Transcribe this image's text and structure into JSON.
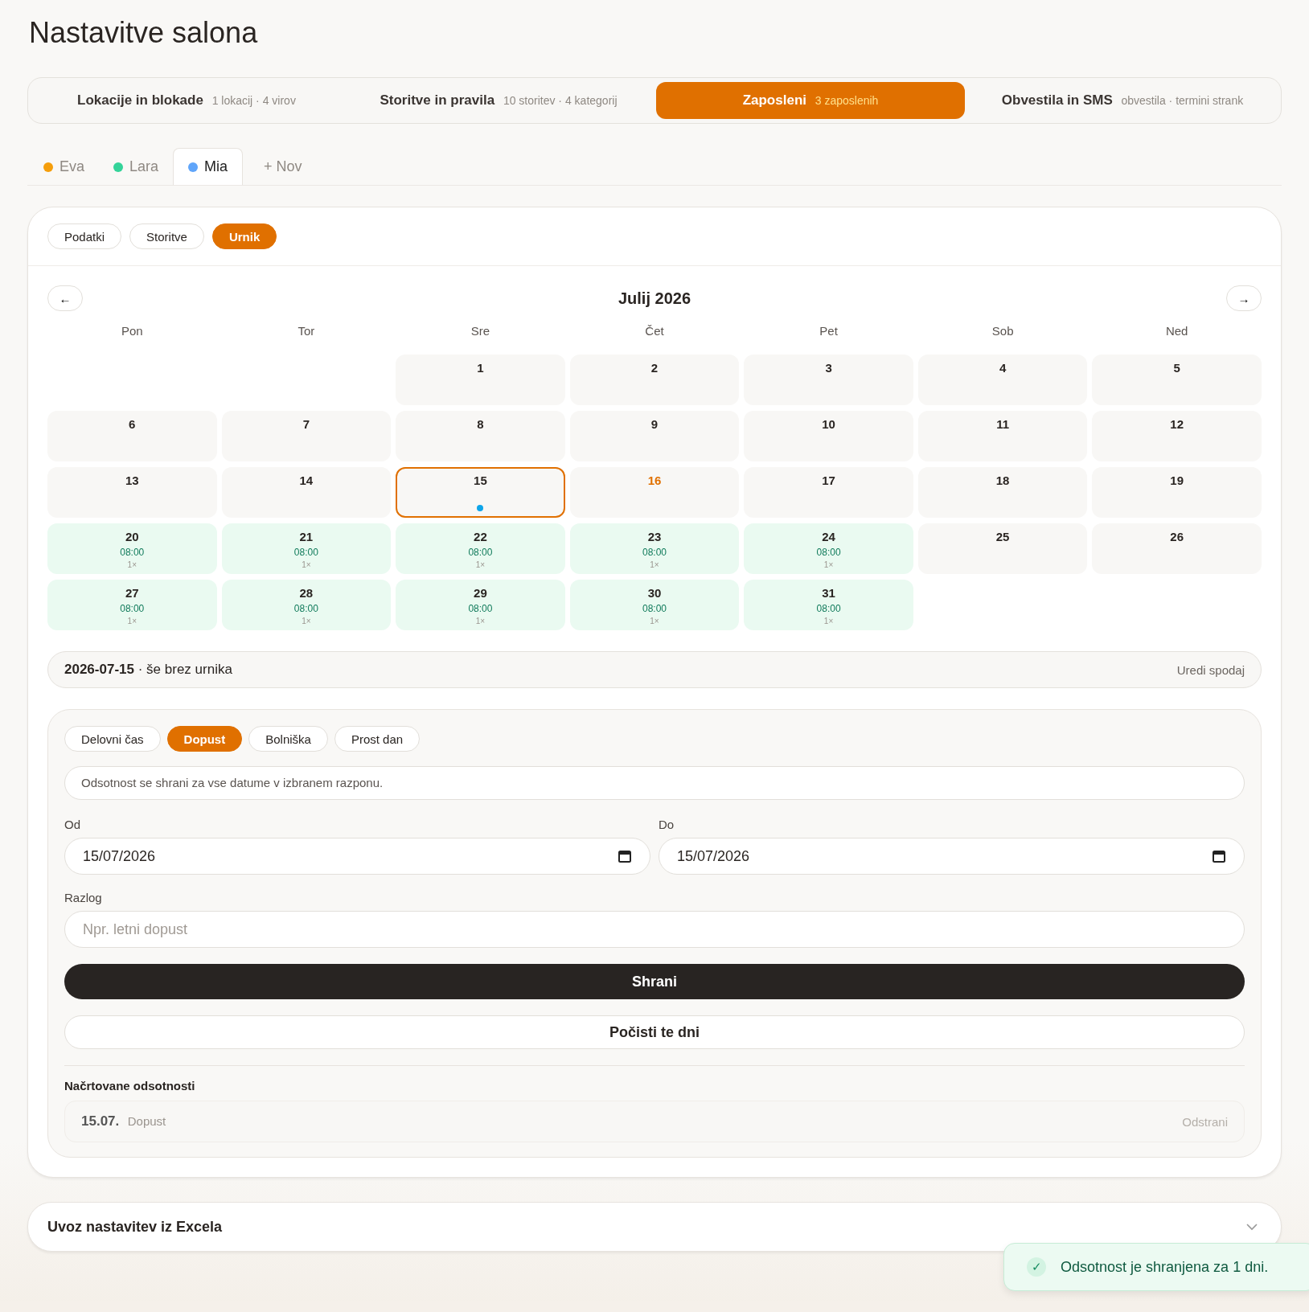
{
  "title": "Nastavitve salona",
  "top_tabs": [
    {
      "label": "Lokacije in blokade",
      "meta": "1 lokacij · 4 virov",
      "selected": false
    },
    {
      "label": "Storitve in pravila",
      "meta": "10 storitev · 4 kategorij",
      "selected": false
    },
    {
      "label": "Zaposleni",
      "meta": "3 zaposlenih",
      "selected": true
    },
    {
      "label": "Obvestila in SMS",
      "meta": "obvestila · termini strank",
      "selected": false
    }
  ],
  "staff_tabs": [
    {
      "label": "Eva",
      "color": "#f59e0b",
      "selected": false
    },
    {
      "label": "Lara",
      "color": "#34d399",
      "selected": false
    },
    {
      "label": "Mia",
      "color": "#60a5fa",
      "selected": true
    }
  ],
  "add_staff": "+ Nov",
  "sub_tabs": [
    {
      "label": "Podatki",
      "selected": false
    },
    {
      "label": "Storitve",
      "selected": false
    },
    {
      "label": "Urnik",
      "selected": true
    }
  ],
  "calendar": {
    "month": "Julij 2026",
    "prev": "←",
    "next": "→",
    "weekdays": [
      "Pon",
      "Tor",
      "Sre",
      "Čet",
      "Pet",
      "Sob",
      "Ned"
    ],
    "days": [
      {
        "kind": "blank"
      },
      {
        "kind": "blank"
      },
      {
        "kind": "day",
        "label": "1",
        "selected": false,
        "today": false,
        "marker": false,
        "scheduled": false
      },
      {
        "kind": "day",
        "label": "2",
        "selected": false,
        "today": false,
        "marker": false,
        "scheduled": false
      },
      {
        "kind": "day",
        "label": "3",
        "selected": false,
        "today": false,
        "marker": false,
        "scheduled": false
      },
      {
        "kind": "day",
        "label": "4",
        "selected": false,
        "today": false,
        "marker": false,
        "scheduled": false
      },
      {
        "kind": "day",
        "label": "5",
        "selected": false,
        "today": false,
        "marker": false,
        "scheduled": false
      },
      {
        "kind": "day",
        "label": "6",
        "selected": false,
        "today": false,
        "marker": false,
        "scheduled": false
      },
      {
        "kind": "day",
        "label": "7",
        "selected": false,
        "today": false,
        "marker": false,
        "scheduled": false
      },
      {
        "kind": "day",
        "label": "8",
        "selected": false,
        "today": false,
        "marker": false,
        "scheduled": false
      },
      {
        "kind": "day",
        "label": "9",
        "selected": false,
        "today": false,
        "marker": false,
        "scheduled": false
      },
      {
        "kind": "day",
        "label": "10",
        "selected": false,
        "today": false,
        "marker": false,
        "scheduled": false
      },
      {
        "kind": "day",
        "label": "11",
        "selected": false,
        "today": false,
        "marker": false,
        "scheduled": false
      },
      {
        "kind": "day",
        "label": "12",
        "selected": false,
        "today": false,
        "marker": false,
        "scheduled": false
      },
      {
        "kind": "day",
        "label": "13",
        "selected": false,
        "today": false,
        "marker": false,
        "scheduled": false
      },
      {
        "kind": "day",
        "label": "14",
        "selected": false,
        "today": false,
        "marker": false,
        "scheduled": false
      },
      {
        "kind": "day",
        "label": "15",
        "selected": true,
        "today": false,
        "marker": true,
        "scheduled": false
      },
      {
        "kind": "day",
        "label": "16",
        "selected": false,
        "today": true,
        "marker": false,
        "scheduled": false
      },
      {
        "kind": "day",
        "label": "17",
        "selected": false,
        "today": false,
        "marker": false,
        "scheduled": false
      },
      {
        "kind": "day",
        "label": "18",
        "selected": false,
        "today": false,
        "marker": false,
        "scheduled": false
      },
      {
        "kind": "day",
        "label": "19",
        "selected": false,
        "today": false,
        "marker": false,
        "scheduled": false
      },
      {
        "kind": "day",
        "label": "20",
        "selected": false,
        "today": false,
        "marker": false,
        "scheduled": true,
        "time": "08:00",
        "count": "1×"
      },
      {
        "kind": "day",
        "label": "21",
        "selected": false,
        "today": false,
        "marker": false,
        "scheduled": true,
        "time": "08:00",
        "count": "1×"
      },
      {
        "kind": "day",
        "label": "22",
        "selected": false,
        "today": false,
        "marker": false,
        "scheduled": true,
        "time": "08:00",
        "count": "1×"
      },
      {
        "kind": "day",
        "label": "23",
        "selected": false,
        "today": false,
        "marker": false,
        "scheduled": true,
        "time": "08:00",
        "count": "1×"
      },
      {
        "kind": "day",
        "label": "24",
        "selected": false,
        "today": false,
        "marker": false,
        "scheduled": true,
        "time": "08:00",
        "count": "1×"
      },
      {
        "kind": "day",
        "label": "25",
        "selected": false,
        "today": false,
        "marker": false,
        "scheduled": false
      },
      {
        "kind": "day",
        "label": "26",
        "selected": false,
        "today": false,
        "marker": false,
        "scheduled": false
      },
      {
        "kind": "day",
        "label": "27",
        "selected": false,
        "today": false,
        "marker": false,
        "scheduled": true,
        "time": "08:00",
        "count": "1×"
      },
      {
        "kind": "day",
        "label": "28",
        "selected": false,
        "today": false,
        "marker": false,
        "scheduled": true,
        "time": "08:00",
        "count": "1×"
      },
      {
        "kind": "day",
        "label": "29",
        "selected": false,
        "today": false,
        "marker": false,
        "scheduled": true,
        "time": "08:00",
        "count": "1×"
      },
      {
        "kind": "day",
        "label": "30",
        "selected": false,
        "today": false,
        "marker": false,
        "scheduled": true,
        "time": "08:00",
        "count": "1×"
      },
      {
        "kind": "day",
        "label": "31",
        "selected": false,
        "today": false,
        "marker": false,
        "scheduled": true,
        "time": "08:00",
        "count": "1×"
      }
    ]
  },
  "day_info": {
    "date": "2026-07-15",
    "note": "· še brez urnika",
    "action": "Uredi spodaj"
  },
  "editor": {
    "types": [
      {
        "label": "Delovni čas",
        "selected": false
      },
      {
        "label": "Dopust",
        "selected": true
      },
      {
        "label": "Bolniška",
        "selected": false
      },
      {
        "label": "Prost dan",
        "selected": false
      }
    ],
    "info": "Odsotnost se shrani za vse datume v izbranem razponu.",
    "from": {
      "label": "Od",
      "value": "15/07/2026"
    },
    "to": {
      "label": "Do",
      "value": "15/07/2026"
    },
    "reason": {
      "label": "Razlog",
      "placeholder": "Npr. letni dopust"
    },
    "save": "Shrani",
    "clear": "Počisti te dni",
    "planned_title": "Načrtovane odsotnosti",
    "planned": [
      {
        "date": "15.07.",
        "type": "Dopust",
        "action": "Odstrani"
      }
    ]
  },
  "import": {
    "title": "Uvoz nastavitev iz Excela",
    "expanded": false
  },
  "toast": {
    "icon": "✓",
    "text": "Odsotnost je shranjena za 1 dni."
  }
}
